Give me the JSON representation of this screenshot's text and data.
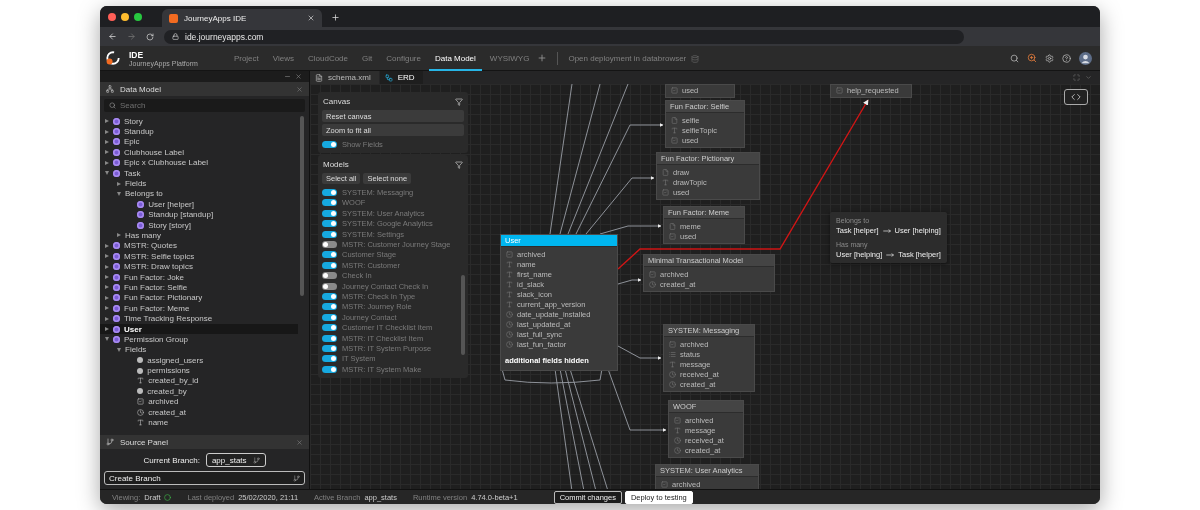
{
  "browser": {
    "tab_title": "JourneyApps IDE",
    "url": "ide.journeyapps.com"
  },
  "app_header": {
    "product": "IDE",
    "subtitle": "JourneyApps Platform",
    "nav": [
      {
        "label": "Project",
        "selected": false
      },
      {
        "label": "Views",
        "selected": false
      },
      {
        "label": "CloudCode",
        "selected": false
      },
      {
        "label": "Git",
        "selected": false
      },
      {
        "label": "Configure",
        "selected": false
      },
      {
        "label": "Data Model",
        "selected": true
      },
      {
        "label": "WYSIWYG",
        "selected": false
      }
    ],
    "link": "Open deployment in databrowser"
  },
  "sidebar": {
    "title": "Data Model",
    "search": {
      "placeholder": "Search"
    },
    "tree": [
      {
        "label": "Story",
        "kind": "model",
        "expanded": false,
        "selected": false
      },
      {
        "label": "Standup",
        "kind": "model",
        "expanded": false,
        "selected": false
      },
      {
        "label": "Epic",
        "kind": "model",
        "expanded": false,
        "selected": false
      },
      {
        "label": "Clubhouse Label",
        "kind": "model",
        "expanded": false,
        "selected": false
      },
      {
        "label": "Epic x Clubhouse Label",
        "kind": "model",
        "expanded": false,
        "selected": false
      },
      {
        "label": "Task",
        "kind": "model",
        "expanded": true,
        "selected": false,
        "children": [
          {
            "label": "Fields",
            "expanded": false,
            "selected": false
          },
          {
            "label": "Belongs to",
            "expanded": true,
            "selected": false,
            "children": [
              {
                "label": "User [helper]",
                "kind": "model",
                "selected": false
              },
              {
                "label": "Standup [standup]",
                "kind": "model",
                "selected": false
              },
              {
                "label": "Story [story]",
                "kind": "model",
                "selected": false
              }
            ]
          },
          {
            "label": "Has many",
            "expanded": false,
            "selected": false
          }
        ]
      },
      {
        "label": "MSTR: Quotes",
        "kind": "model",
        "expanded": false,
        "selected": false
      },
      {
        "label": "MSTR: Selfie topics",
        "kind": "model",
        "expanded": false,
        "selected": false
      },
      {
        "label": "MSTR: Draw topics",
        "kind": "model",
        "expanded": false,
        "selected": false
      },
      {
        "label": "Fun Factor: Joke",
        "kind": "model",
        "expanded": false,
        "selected": false
      },
      {
        "label": "Fun Factor: Selfie",
        "kind": "model",
        "expanded": false,
        "selected": false
      },
      {
        "label": "Fun Factor: Pictionary",
        "kind": "model",
        "expanded": false,
        "selected": false
      },
      {
        "label": "Fun Factor: Meme",
        "kind": "model",
        "expanded": false,
        "selected": false
      },
      {
        "label": "Time Tracking Response",
        "kind": "model",
        "expanded": false,
        "selected": false
      },
      {
        "label": "User",
        "kind": "model",
        "expanded": false,
        "selected": true
      },
      {
        "label": "Permission Group",
        "kind": "model",
        "expanded": true,
        "selected": false,
        "children": [
          {
            "label": "Fields",
            "expanded": true,
            "selected": false,
            "children": [
              {
                "label": "assigned_users",
                "kind": "relation",
                "selected": false
              },
              {
                "label": "permissions",
                "kind": "relation",
                "selected": false
              },
              {
                "label": "created_by_id",
                "kind": "text",
                "selected": false
              },
              {
                "label": "created_by",
                "kind": "relation",
                "selected": false
              },
              {
                "label": "archived",
                "kind": "boolean",
                "selected": false
              },
              {
                "label": "created_at",
                "kind": "datetime",
                "selected": false
              },
              {
                "label": "name",
                "kind": "text",
                "selected": false
              }
            ]
          }
        ]
      }
    ]
  },
  "source_panel": {
    "title": "Source Panel",
    "branch_label": "Current Branch:",
    "branch": "app_stats",
    "create_label": "Create Branch"
  },
  "editor_tabs": [
    {
      "label": "schema.xml",
      "kind": "file",
      "selected": false
    },
    {
      "label": "ERD",
      "kind": "diagram",
      "selected": true
    }
  ],
  "canvas_panel": {
    "title": "Canvas",
    "buttons": [
      "Reset canvas",
      "Zoom to fit all"
    ],
    "show_fields": {
      "label": "Show Fields",
      "on": true
    }
  },
  "models_panel": {
    "title": "Models",
    "buttons": [
      "Select all",
      "Select none"
    ],
    "models": [
      {
        "label": "SYSTEM: Messaging",
        "on": true
      },
      {
        "label": "WOOF",
        "on": true
      },
      {
        "label": "SYSTEM: User Analytics",
        "on": true
      },
      {
        "label": "SYSTEM: Google Analytics",
        "on": true
      },
      {
        "label": "SYSTEM: Settings",
        "on": true
      },
      {
        "label": "MSTR: Customer Journey Stage",
        "on": false
      },
      {
        "label": "Customer Stage",
        "on": true
      },
      {
        "label": "MSTR: Customer",
        "on": true
      },
      {
        "label": "Check In",
        "on": false
      },
      {
        "label": "Journey Contact Check In",
        "on": false
      },
      {
        "label": "MSTR: Check In Type",
        "on": true
      },
      {
        "label": "MSTR: Journey Role",
        "on": true
      },
      {
        "label": "Journey Contact",
        "on": true
      },
      {
        "label": "Customer IT Checklist Item",
        "on": true
      },
      {
        "label": "MSTR: IT Checklist Item",
        "on": true
      },
      {
        "label": "MSTR: IT System Purpose",
        "on": true
      },
      {
        "label": "IT System",
        "on": true
      },
      {
        "label": "MSTR: IT System Make",
        "on": true
      }
    ]
  },
  "erd": {
    "nodes": [
      {
        "fields": [
          {
            "name": "used",
            "kind": "boolean"
          }
        ]
      },
      {
        "title": "Fun Factor: Selfie",
        "selected": false,
        "fields": [
          {
            "name": "selfie",
            "kind": "file"
          },
          {
            "name": "selfieTopic",
            "kind": "text"
          },
          {
            "name": "used",
            "kind": "boolean"
          }
        ]
      },
      {
        "title": "Fun Factor: Pictionary",
        "selected": false,
        "fields": [
          {
            "name": "draw",
            "kind": "file"
          },
          {
            "name": "drawTopic",
            "kind": "text"
          },
          {
            "name": "used",
            "kind": "boolean"
          }
        ]
      },
      {
        "title": "Fun Factor: Meme",
        "selected": false,
        "fields": [
          {
            "name": "meme",
            "kind": "file"
          },
          {
            "name": "used",
            "kind": "boolean"
          }
        ]
      },
      {
        "title": "User",
        "selected": true,
        "fields": [
          {
            "name": "archived",
            "kind": "boolean"
          },
          {
            "name": "name",
            "kind": "text"
          },
          {
            "name": "first_name",
            "kind": "text"
          },
          {
            "name": "id_slack",
            "kind": "text"
          },
          {
            "name": "slack_icon",
            "kind": "text"
          },
          {
            "name": "current_app_version",
            "kind": "text"
          },
          {
            "name": "date_update_installed",
            "kind": "datetime"
          },
          {
            "name": "last_updated_at",
            "kind": "datetime"
          },
          {
            "name": "last_full_sync",
            "kind": "datetime"
          },
          {
            "name": "last_fun_factor",
            "kind": "datetime"
          }
        ],
        "footer": "additional fields hidden"
      },
      {
        "title": "Minimal Transactional Model",
        "selected": false,
        "fields": [
          {
            "name": "archived",
            "kind": "boolean"
          },
          {
            "name": "created_at",
            "kind": "datetime"
          }
        ]
      },
      {
        "fields": [
          {
            "name": "help_requested",
            "kind": "boolean"
          }
        ]
      },
      {
        "title": "SYSTEM: Messaging",
        "selected": false,
        "fields": [
          {
            "name": "archived",
            "kind": "boolean"
          },
          {
            "name": "status",
            "kind": "choice"
          },
          {
            "name": "message",
            "kind": "text"
          },
          {
            "name": "received_at",
            "kind": "datetime"
          },
          {
            "name": "created_at",
            "kind": "datetime"
          }
        ]
      },
      {
        "title": "WOOF",
        "selected": false,
        "fields": [
          {
            "name": "archived",
            "kind": "boolean"
          },
          {
            "name": "message",
            "kind": "text"
          },
          {
            "name": "received_at",
            "kind": "datetime"
          },
          {
            "name": "created_at",
            "kind": "datetime"
          }
        ]
      },
      {
        "title": "SYSTEM: User Analytics",
        "selected": false,
        "fields": [
          {
            "name": "archived",
            "kind": "boolean"
          }
        ]
      }
    ],
    "tooltip": [
      {
        "heading": "Belongs to",
        "from": "Task [helper]",
        "to": "User [helping]"
      },
      {
        "heading": "Has many",
        "from": "User [helping]",
        "to": "Task [helper]"
      }
    ]
  },
  "status_bar": {
    "items": [
      {
        "label": "Viewing:",
        "value": "Draft"
      },
      {
        "label": "Last deployed",
        "value": "25/02/2020, 21:11"
      },
      {
        "label": "Active Branch",
        "value": "app_stats"
      },
      {
        "label": "Runtime version",
        "value": "4.74.0-beta+1"
      }
    ],
    "buttons": [
      {
        "label": "Commit changes",
        "kind": "secondary"
      },
      {
        "label": "Deploy to testing",
        "kind": "primary"
      }
    ]
  }
}
